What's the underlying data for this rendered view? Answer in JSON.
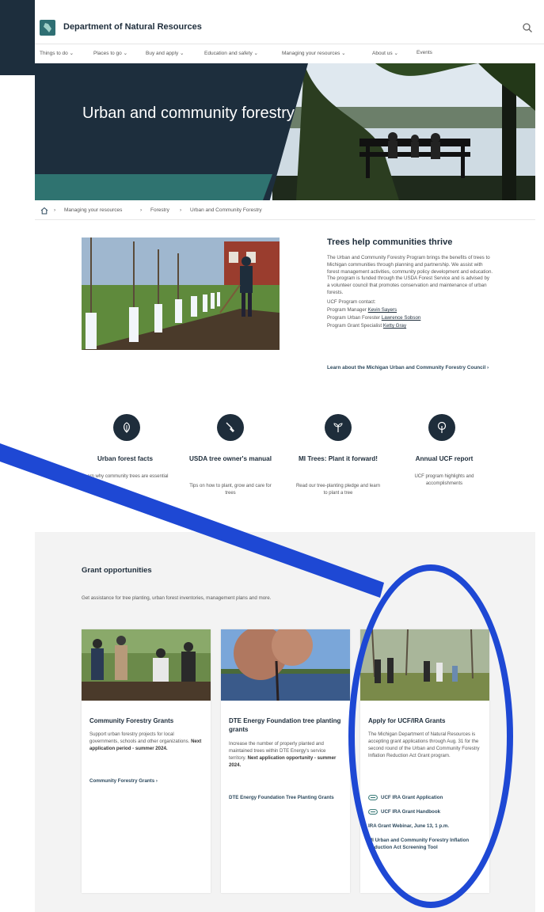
{
  "header": {
    "brand": "Department of Natural Resources",
    "nav": [
      "Things to do",
      "Places to go",
      "Buy and apply",
      "Education and safety",
      "Managing your resources",
      "About us",
      "Events"
    ]
  },
  "hero": {
    "title": "Urban and community forestry"
  },
  "breadcrumb": [
    "Managing your resources",
    "Forestry",
    "Urban and Community Forestry"
  ],
  "intro": {
    "heading": "Trees help communities thrive",
    "body": "The Urban and Community Forestry Program brings the benefits of trees to Michigan communities through planning and partnership. We assist with forest management activities, community policy development and education. The program is funded through the USDA Forest Service and is advised by a volunteer council that promotes conservation and maintenance of urban forests.",
    "contact_label": "UCF Program contact:",
    "contacts": [
      {
        "role": "Program Manager",
        "name": "Kevin Sayers"
      },
      {
        "role": "Program Urban Forester",
        "name": "Lawrence Sobson"
      },
      {
        "role": "Program Grant Specialist",
        "name": "Ketty Gray"
      }
    ],
    "council_link": "Learn about the Michigan Urban and Community Forestry Council"
  },
  "features": [
    {
      "title": "Urban forest facts",
      "desc": "Learn why community trees are essential",
      "icon": "leaf-icon"
    },
    {
      "title": "USDA tree owner's manual",
      "desc": "Tips on how to plant, grow and care for trees",
      "icon": "shovel-icon"
    },
    {
      "title": "MI Trees: Plant it forward!",
      "desc": "Read our tree-planting pledge and learn to plant a tree",
      "icon": "sprout-icon"
    },
    {
      "title": "Annual UCF report",
      "desc": "UCF program highlights and accomplishments",
      "icon": "tree-icon"
    }
  ],
  "grants": {
    "heading": "Grant opportunities",
    "intro": "Get assistance for tree planting, urban forest inventories, management plans and more.",
    "cards": [
      {
        "title": "Community Forestry Grants",
        "body": "Support urban forestry projects for local governments, schools and other organizations.",
        "body_bold": "Next application period - summer 2024.",
        "links": [
          "Community Forestry Grants"
        ]
      },
      {
        "title": "DTE Energy Foundation tree planting grants",
        "body": "Increase the number of properly planted and maintained trees within DTE Energy's service territory.",
        "body_bold": "Next application opportunity - summer 2024.",
        "links": [
          "DTE Energy Foundation Tree Planting Grants"
        ]
      },
      {
        "title": "Apply for UCF/IRA Grants",
        "body": "The Michigan Department of Natural Resources is accepting grant applications through Aug. 31 for the second round of the Urban and Community Forestry Inflation Reduction Act Grant program.",
        "body_bold": "",
        "links": [
          "UCF IRA Grant Application",
          "UCF IRA Grant Handbook",
          "IRA Grant Webinar, June 13, 1 p.m.",
          "MI Urban and Community Forestry Inflation Reduction Act Screening Tool"
        ]
      }
    ]
  },
  "colors": {
    "navy": "#1e2d3b",
    "teal": "#2f7370",
    "annotation": "#1e48d4"
  }
}
